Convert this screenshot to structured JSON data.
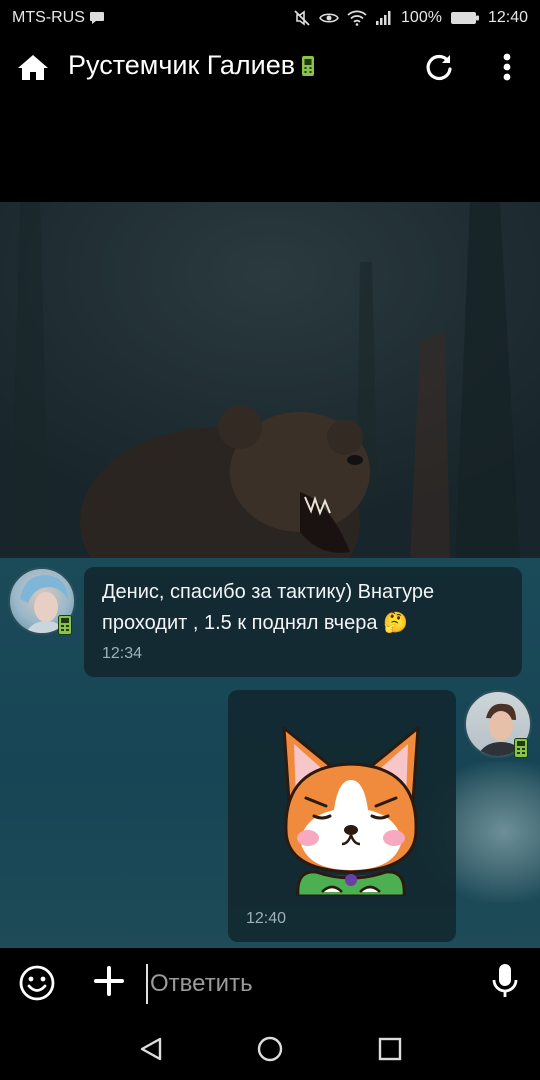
{
  "status_bar": {
    "carrier": "MTS-RUS",
    "battery_percent": "100%",
    "time": "12:40",
    "icons": [
      "chat-bubble-icon",
      "mute-icon",
      "eye-icon",
      "wifi-icon",
      "signal-icon",
      "battery-icon"
    ]
  },
  "header": {
    "title": "Рустемчик Галиев",
    "icons": [
      "home-icon",
      "device-icon",
      "refresh-icon",
      "more-vert-icon"
    ]
  },
  "messages": [
    {
      "direction": "incoming",
      "text": "Денис, спасибо за тактику) Внатуре проходит , 1.5 к поднял вчера",
      "emoji": "🤔",
      "time": "12:34"
    },
    {
      "direction": "outgoing",
      "type": "sticker",
      "sticker": "corgi",
      "time": "12:40"
    }
  ],
  "input_bar": {
    "placeholder": "Ответить",
    "icons": [
      "emoji-icon",
      "plus-icon",
      "microphone-icon"
    ]
  },
  "nav_bar": {
    "icons": [
      "back-icon",
      "home-circle-icon",
      "recents-icon"
    ]
  },
  "colors": {
    "accent_green": "#8bc34a",
    "bubble_bg": "#122830",
    "sticker_orange": "#f08a3c",
    "sticker_green": "#4caf50"
  }
}
